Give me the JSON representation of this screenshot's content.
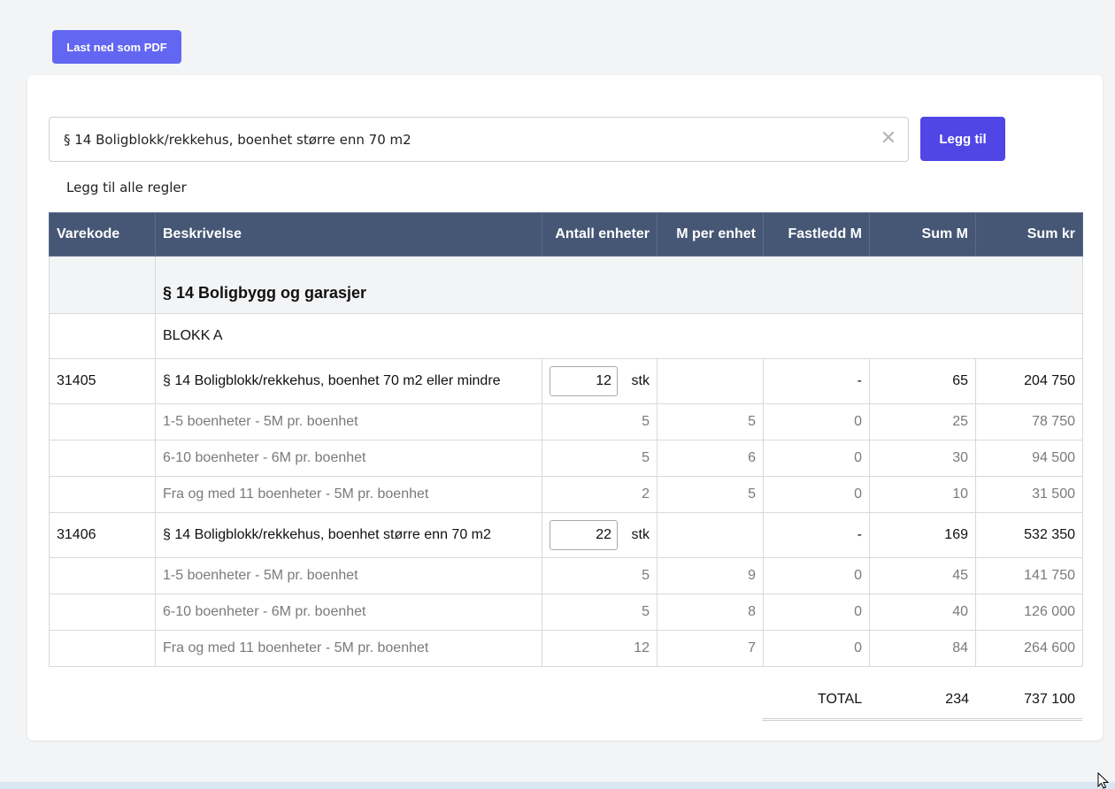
{
  "toolbar": {
    "pdf_label": "Last ned som PDF"
  },
  "search": {
    "value": "§ 14 Boligblokk/rekkehus, boenhet større enn 70 m2",
    "clear_symbol": "✕",
    "add_label": "Legg til",
    "add_all_label": "Legg til alle regler"
  },
  "table": {
    "headers": [
      "Varekode",
      "Beskrivelse",
      "Antall enheter",
      "M per enhet",
      "Fastledd M",
      "Sum M",
      "Sum kr"
    ],
    "section_title": "§ 14 Boligbygg og garasjer",
    "group_title": "BLOKK A",
    "items": [
      {
        "code": "31405",
        "description": "§ 14 Boligblokk/rekkehus, boenhet 70 m2 eller mindre",
        "quantity": "12",
        "unit": "stk",
        "fixed": "-",
        "sum_m": "65",
        "sum_kr": "204 750",
        "sub": [
          {
            "description": "1-5 boenheter - 5M pr. boenhet",
            "units": "5",
            "m_per": "5",
            "fixed": "0",
            "sum_m": "25",
            "sum_kr": "78 750"
          },
          {
            "description": "6-10 boenheter - 6M pr. boenhet",
            "units": "5",
            "m_per": "6",
            "fixed": "0",
            "sum_m": "30",
            "sum_kr": "94 500"
          },
          {
            "description": "Fra og med 11 boenheter - 5M pr. boenhet",
            "units": "2",
            "m_per": "5",
            "fixed": "0",
            "sum_m": "10",
            "sum_kr": "31 500"
          }
        ]
      },
      {
        "code": "31406",
        "description": "§ 14 Boligblokk/rekkehus, boenhet større enn 70 m2",
        "quantity": "22",
        "unit": "stk",
        "fixed": "-",
        "sum_m": "169",
        "sum_kr": "532 350",
        "sub": [
          {
            "description": "1-5 boenheter - 5M pr. boenhet",
            "units": "5",
            "m_per": "9",
            "fixed": "0",
            "sum_m": "45",
            "sum_kr": "141 750"
          },
          {
            "description": "6-10 boenheter - 6M pr. boenhet",
            "units": "5",
            "m_per": "8",
            "fixed": "0",
            "sum_m": "40",
            "sum_kr": "126 000"
          },
          {
            "description": "Fra og med 11 boenheter - 5M pr. boenhet",
            "units": "12",
            "m_per": "7",
            "fixed": "0",
            "sum_m": "84",
            "sum_kr": "264 600"
          }
        ]
      }
    ]
  },
  "total": {
    "label": "TOTAL",
    "sum_m": "234",
    "sum_kr": "737 100"
  },
  "colors": {
    "primary": "#4f46e5",
    "pdf_button": "#6366f1",
    "table_header": "#465775"
  },
  "icons": {
    "clear": "close-icon",
    "cursor": "mouse-pointer-icon"
  }
}
